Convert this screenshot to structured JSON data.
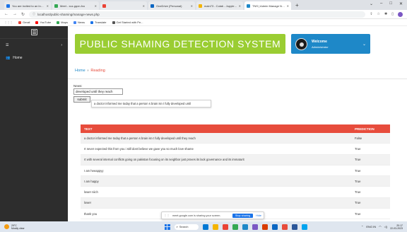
{
  "browser": {
    "tabs": [
      {
        "label": "You are invited to an Instanc",
        "color": "#1a73e8",
        "active": false
      },
      {
        "label": "Meet - xcz-gqxn-fxo",
        "color": "#34a853",
        "active": false
      },
      {
        "label": "",
        "color": "#ea4335",
        "active": false
      },
      {
        "label": "OneDrive (Personal)",
        "color": "#0a66c2",
        "active": false
      },
      {
        "label": "main73 - Colab - Jupyter Noteb",
        "color": "#f4b400",
        "active": false
      },
      {
        "label": "TNS | Admin Manage News",
        "color": "#1e88c8",
        "active": true
      }
    ],
    "new_tab": "+",
    "window_controls": [
      "⌄",
      "–",
      "□",
      "✕"
    ],
    "url": "localhost/public-shaming/manage-news.php",
    "bookmarks": [
      {
        "label": "Gmail",
        "color": "#ea4335"
      },
      {
        "label": "YouTube",
        "color": "#ff0000"
      },
      {
        "label": "Maps",
        "color": "#34a853"
      },
      {
        "label": "News",
        "color": "#4285f4"
      },
      {
        "label": "Translate",
        "color": "#1a73e8"
      },
      {
        "label": "Get Started with Pe...",
        "color": "#555555"
      }
    ]
  },
  "sidebar": {
    "items": [
      {
        "label": "",
        "icon": "menu-icon",
        "chevron": "›"
      },
      {
        "label": "Home",
        "icon": "users-icon",
        "chevron": ""
      }
    ]
  },
  "header": {
    "title": "PUBLIC SHAMING DETECTION SYSTEM",
    "welcome_title": "Welcome",
    "welcome_role": "Administrator",
    "welcome_chevron": "⌄"
  },
  "breadcrumb": {
    "home": "Home",
    "separator": "›",
    "current": "Reading"
  },
  "form": {
    "news_label": "News:",
    "news_value": "developed until they reach",
    "submit_label": "submit",
    "suggestion": "a doctor informed me today that a person s brain isn t fully developed until"
  },
  "table": {
    "headers": [
      "TEXT",
      "PREDICTION"
    ],
    "rows": [
      [
        "a doctor informed me today that a person s brain isn t fully developed until they reach",
        "False"
      ],
      [
        "rt never expected this from you i still dont believe we gave you so much love shame",
        "True"
      ],
      [
        "rt with several internal conflicts going on pakistan focusing on its neighbor just proves its lack governance and its immaturit",
        "True"
      ],
      [
        "I am heeappyy",
        "True"
      ],
      [
        "I am happy",
        "True"
      ],
      [
        "lower niich",
        "True"
      ],
      [
        "lower",
        "True"
      ],
      [
        "thank you",
        "True"
      ]
    ]
  },
  "share_bar": {
    "text": "meet.google.com is sharing your screen.",
    "stop_label": "Stop sharing",
    "hide_label": "Hide"
  },
  "taskbar": {
    "temperature": "29°C",
    "weather": "Mostly clear",
    "search_label": "Search",
    "apps": [
      "#0078d4",
      "#f4b400",
      "#ea4335",
      "#34a853",
      "#1e88c8",
      "#7b57c4",
      "#d83b01",
      "#0a66c2",
      "#e74c3c",
      "#2b579a",
      "#00a4ef"
    ],
    "clock_time": "20:17",
    "clock_date": "22-03-2023",
    "lang": "ENG IN"
  }
}
